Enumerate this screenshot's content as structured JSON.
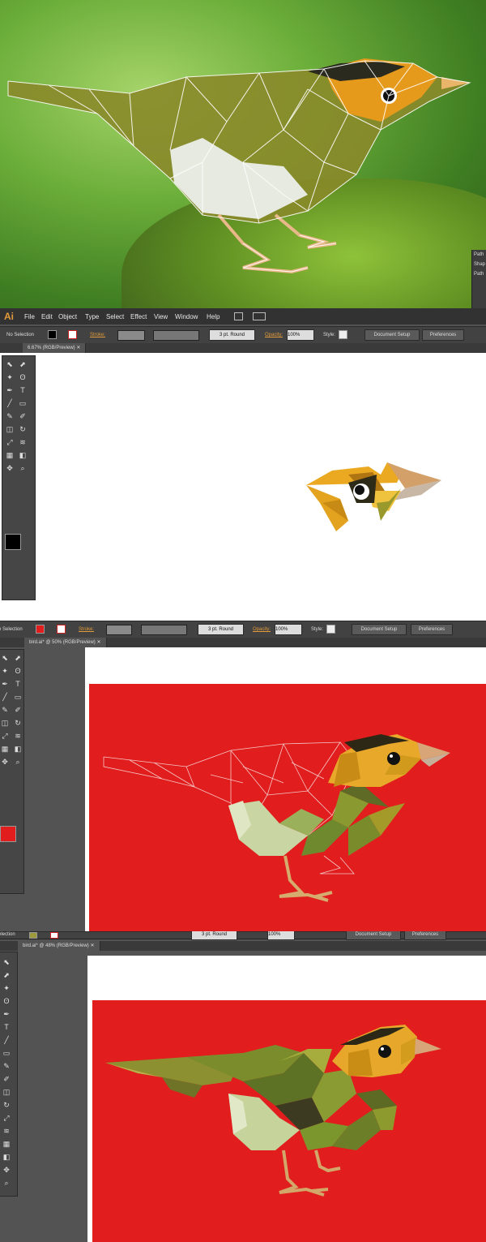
{
  "menubar": {
    "logo": "Ai",
    "items": [
      "File",
      "Edit",
      "Object",
      "Type",
      "Select",
      "Effect",
      "View",
      "Window",
      "Help"
    ]
  },
  "control_bar": {
    "selection_label": "No Selection",
    "stroke_label": "Stroke:",
    "brush_label": "3 pt. Round",
    "opacity_label": "Opacity:",
    "opacity_value": "100%",
    "style_label": "Style:",
    "document_setup_label": "Document Setup",
    "preferences_label": "Preferences",
    "selection_label_cut": "n Selection",
    "selection_label_cut2": "election"
  },
  "doc_tabs": {
    "tab1": "6.67% (RGB/Preview)",
    "tab2": "bird.ai* @ 50% (RGB/Preview)",
    "tab3": "bird.ai* @ 48% (RGB/Preview)"
  },
  "side_panel": {
    "items": [
      "Path",
      "Shap",
      "Path"
    ]
  },
  "colors": {
    "accent_orange": "#e29b3a",
    "canvas_red": "#e11d1d",
    "fill_black": "#000000",
    "fill_red": "#e11d1d",
    "fill_olive": "#9c9a3c"
  },
  "icons": [
    "pointer-icon",
    "direct-select-icon",
    "magic-wand-icon",
    "lasso-icon",
    "pen-icon",
    "type-icon",
    "line-icon",
    "rectangle-icon",
    "brush-icon",
    "pencil-icon",
    "eraser-icon",
    "rotate-icon",
    "scale-icon",
    "graph-icon",
    "gradient-icon",
    "eyedropper-icon",
    "hand-icon",
    "zoom-icon"
  ]
}
